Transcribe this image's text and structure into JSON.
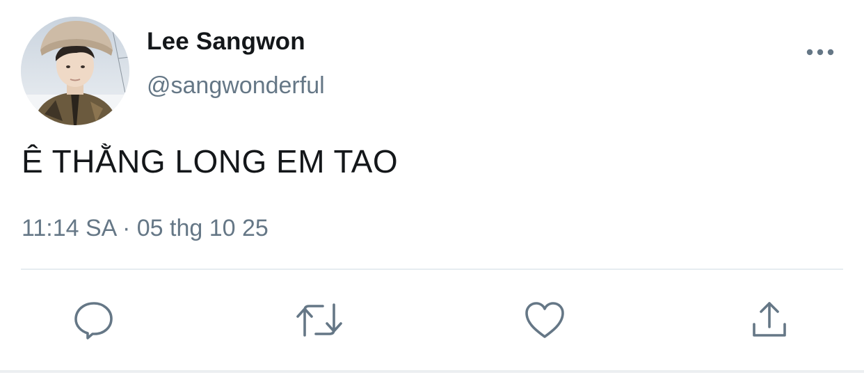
{
  "tweet": {
    "author": {
      "display_name": "Lee Sangwon",
      "handle": "@sangwonderful"
    },
    "text": "Ê THẰNG LONG EM TAO",
    "meta": {
      "time": "11:14 SA",
      "separator": "·",
      "date": "05 thg 10 25"
    },
    "actions": [
      "reply-icon",
      "retweet-icon",
      "like-icon",
      "share-icon"
    ],
    "colors": {
      "primary_text": "#14171a",
      "secondary_text": "#657786",
      "icon": "#657786",
      "divider": "#e6ecf0"
    }
  }
}
